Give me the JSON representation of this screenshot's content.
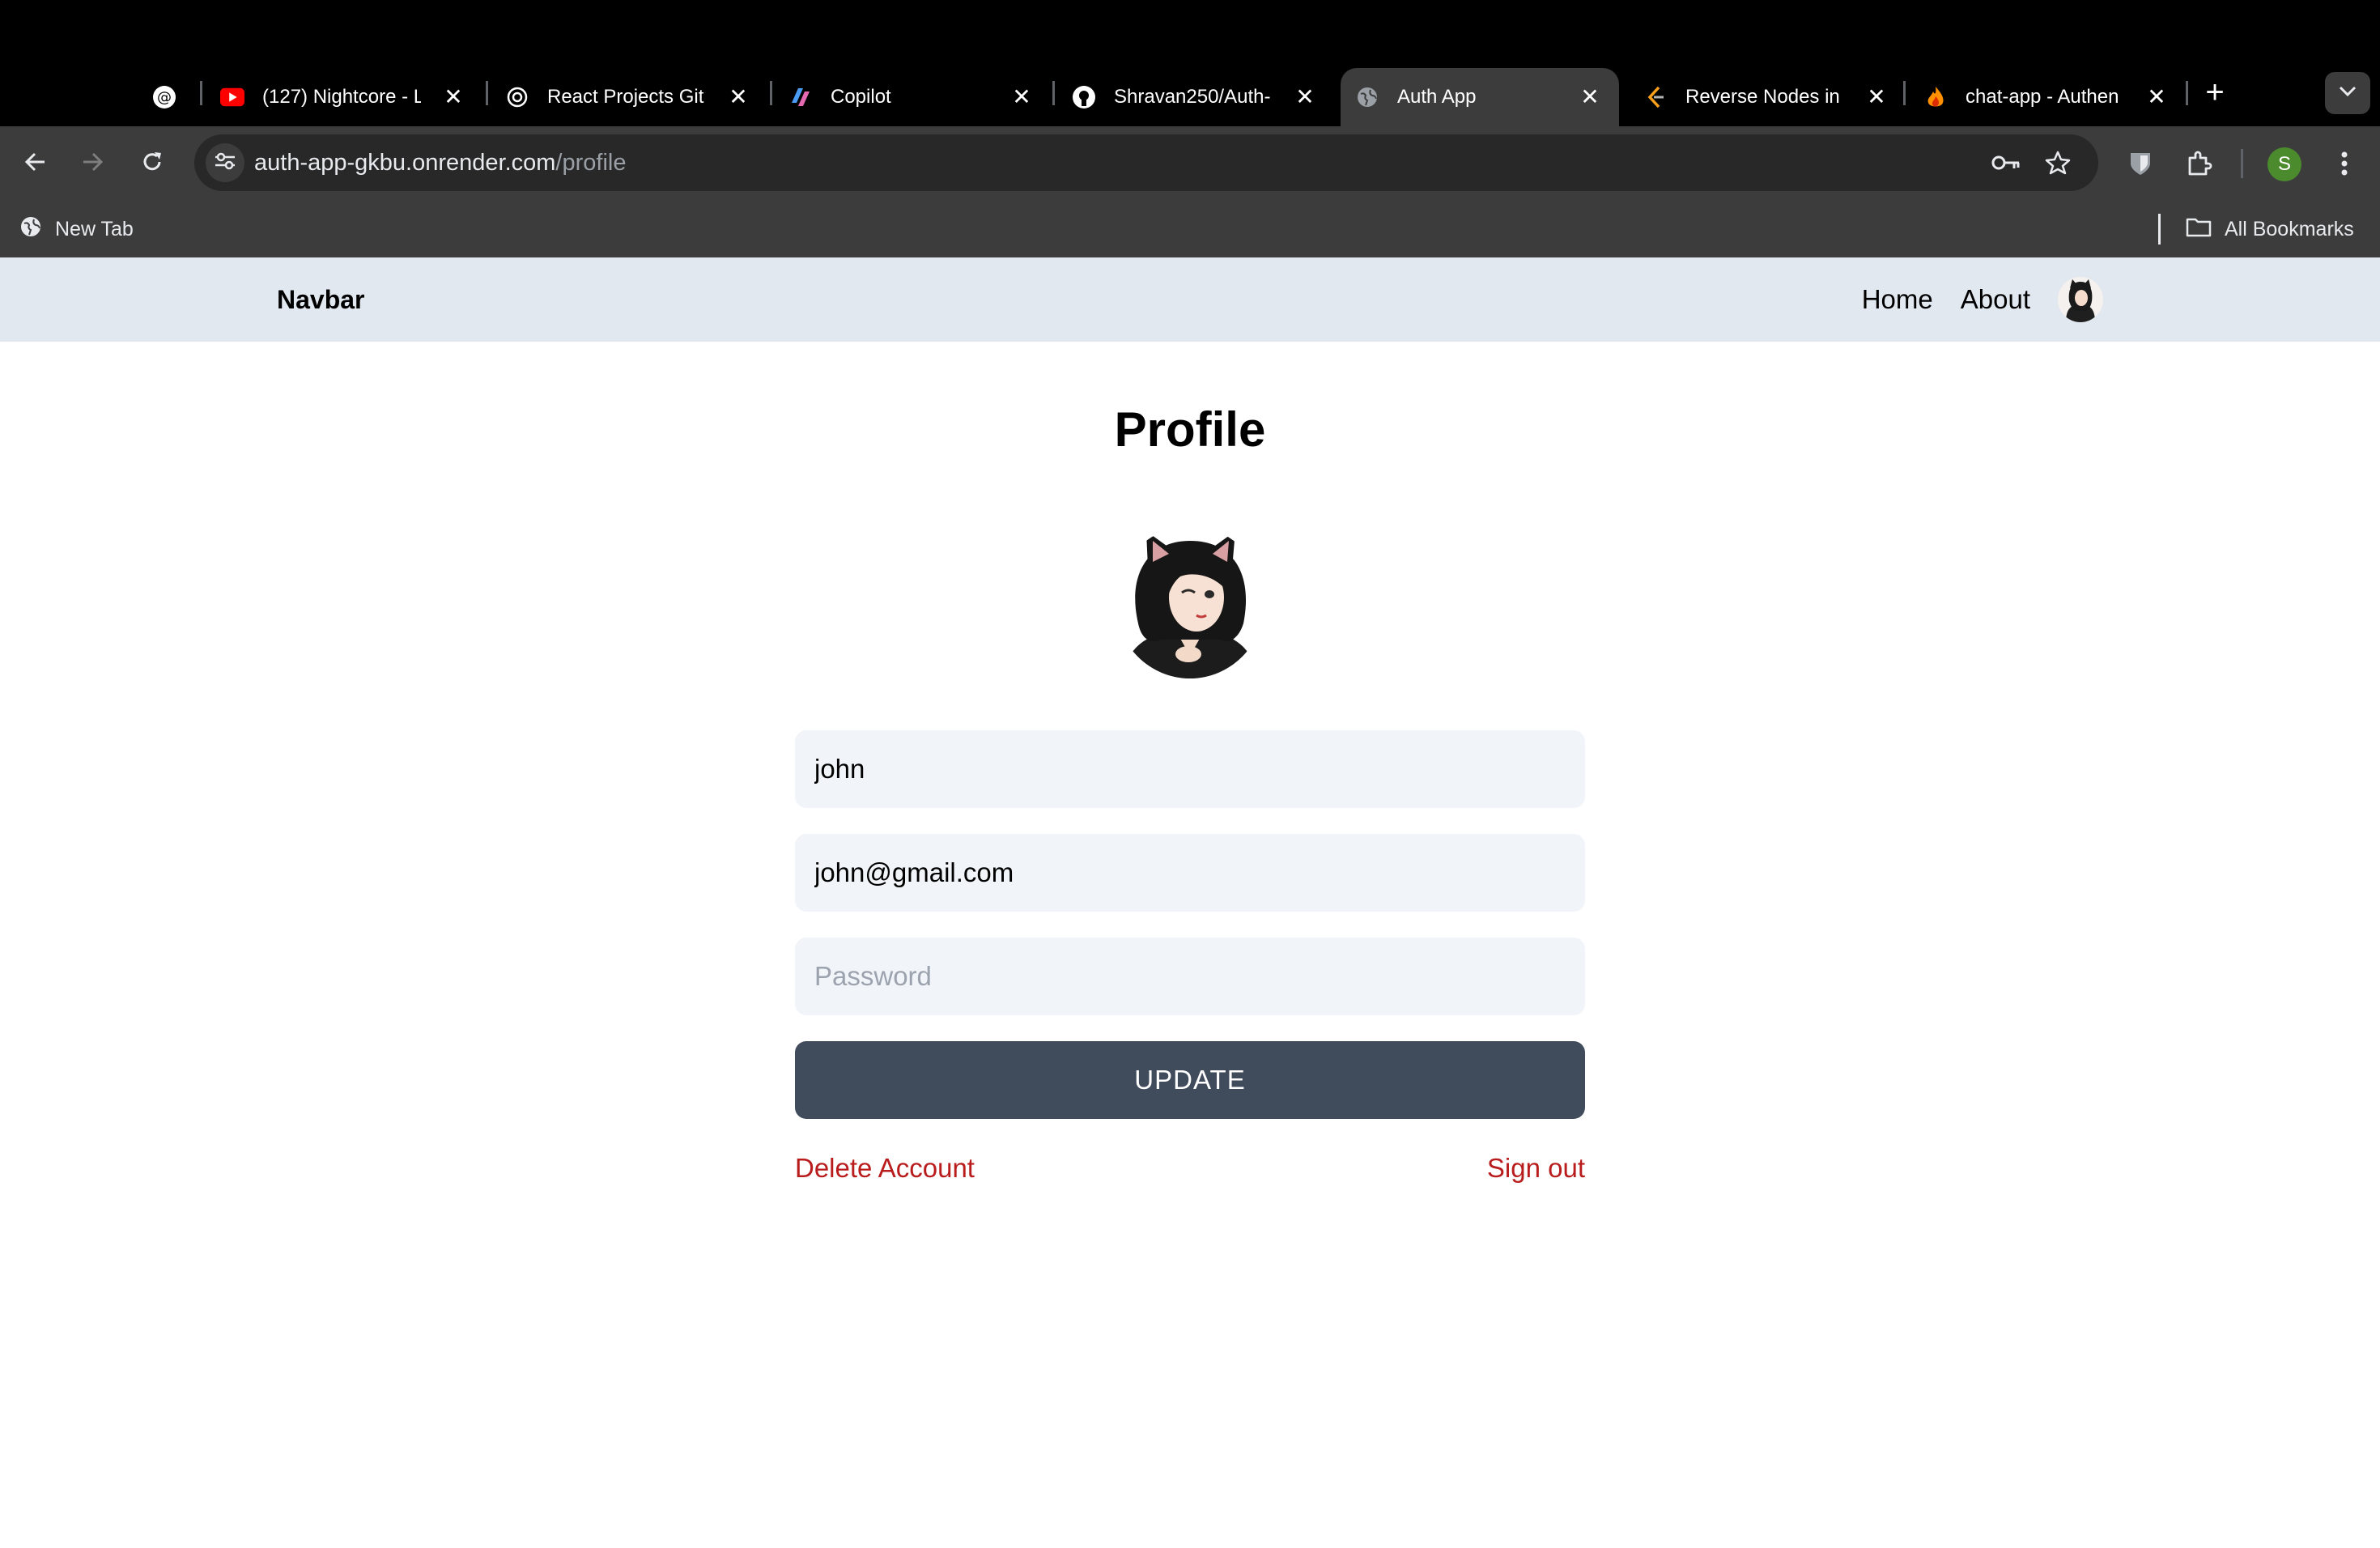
{
  "browser": {
    "tabs": [
      {
        "title": "",
        "icon": "threads-icon",
        "close": "✕"
      },
      {
        "title": "(127) Nightcore - L",
        "icon": "youtube-icon",
        "close": "✕"
      },
      {
        "title": "React Projects Git",
        "icon": "chatgpt-icon",
        "close": "✕"
      },
      {
        "title": "Copilot",
        "icon": "copilot-icon",
        "close": "✕"
      },
      {
        "title": "Shravan250/Auth-",
        "icon": "github-icon",
        "close": "✕"
      },
      {
        "title": "Auth App",
        "icon": "globe-icon",
        "close": "✕",
        "active": true
      },
      {
        "title": "Reverse Nodes in",
        "icon": "leetcode-icon",
        "close": "✕"
      },
      {
        "title": "chat-app - Authen",
        "icon": "firebase-icon",
        "close": "✕"
      }
    ],
    "new_tab": "+",
    "url_host": "auth-app-gkbu.onrender.com",
    "url_path": "/profile",
    "profile_initial": "S",
    "bookmarks": {
      "new_tab": "New Tab",
      "all": "All Bookmarks"
    }
  },
  "navbar": {
    "brand": "Navbar",
    "links": {
      "home": "Home",
      "about": "About"
    }
  },
  "profile": {
    "title": "Profile",
    "username": "john",
    "email": "john@gmail.com",
    "password_placeholder": "Password",
    "update_label": "UPDATE",
    "delete_label": "Delete Account",
    "signout_label": "Sign out"
  },
  "colors": {
    "navbar_bg": "#e2e8f0",
    "input_bg": "#f1f5f9",
    "button_bg": "#404b5b",
    "danger": "#b91c1c"
  }
}
